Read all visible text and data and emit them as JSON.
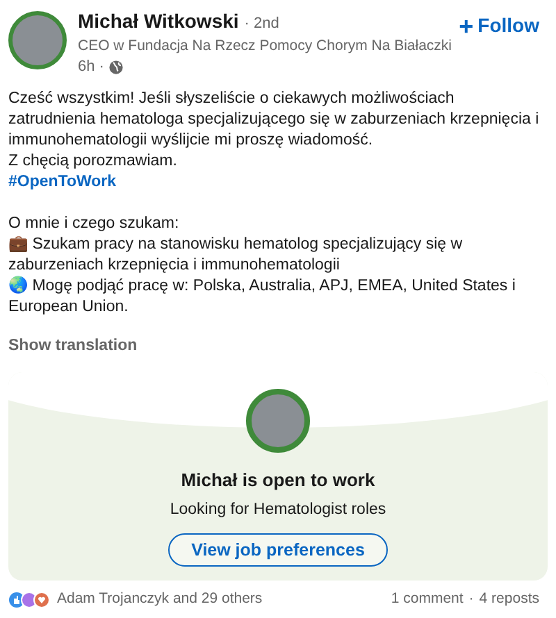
{
  "author": {
    "name": "Michał Witkowski",
    "degree": "· 2nd",
    "headline": "CEO w Fundacja Na Rzecz Pomocy Chorym Na Białaczki",
    "time": "6h ·"
  },
  "follow_button": {
    "icon": "+",
    "label": "Follow"
  },
  "post_body": [
    {
      "kind": "text",
      "text": "Cześć wszystkim! Jeśli słyszeliście o ciekawych możliwościach zatrudnienia hematologa specjalizującego się w zaburzeniach krzepnięcia i immunohematologii wyślijcie mi proszę wiadomość."
    },
    {
      "kind": "text",
      "text": "Z chęcią porozmawiam."
    },
    {
      "kind": "hashtag",
      "text": "#OpenToWork"
    },
    {
      "kind": "gap"
    },
    {
      "kind": "text",
      "text": "O mnie i czego szukam:"
    },
    {
      "kind": "text",
      "text": "💼 Szukam pracy na stanowisku hematolog specjalizujący się w zaburzeniach krzepnięcia i immunohematologii"
    },
    {
      "kind": "text",
      "text": "🌏 Mogę podjąć pracę w: Polska, Australia, APJ, EMEA, United States i European Union."
    }
  ],
  "show_translation": "Show translation",
  "open_to_work_card": {
    "title": "Michał is open to work",
    "subtitle": "Looking for Hematologist roles",
    "button": "View job preferences"
  },
  "social_bar": {
    "reactions": "Adam Trojanczyk and 29 others",
    "comments": "1 comment",
    "separator": "·",
    "reposts": "4 reposts"
  }
}
